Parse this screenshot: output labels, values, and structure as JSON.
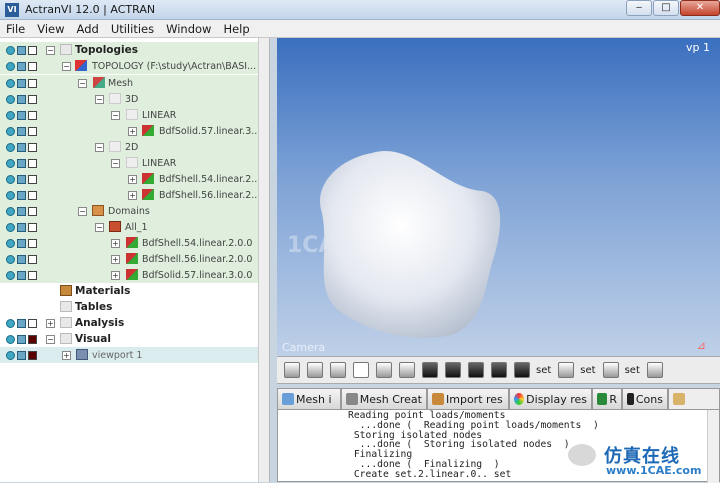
{
  "window": {
    "title": "ActranVI 12.0 | ACTRAN",
    "app_icon": "VI",
    "minimize": "‒",
    "maximize": "□",
    "close": "✕"
  },
  "menu": [
    "File",
    "View",
    "Add",
    "Utilities",
    "Window",
    "Help"
  ],
  "tree": {
    "topologies": "Topologies",
    "topology": "TOPOLOGY (F:\\study\\Actran\\BASI...",
    "mesh": "Mesh",
    "d3": "3D",
    "linear3": "LINEAR",
    "bdfsolid": "BdfSolid.57.linear.3....",
    "d2": "2D",
    "linear2": "LINEAR",
    "bdfshell54": "BdfShell.54.linear.2....",
    "bdfshell56": "BdfShell.56.linear.2....",
    "domains": "Domains",
    "all1": "All_1",
    "dom_shell54": "BdfShell.54.linear.2.0.0",
    "dom_shell56": "BdfShell.56.linear.2.0.0",
    "dom_solid57": "BdfSolid.57.linear.3.0.0",
    "materials": "Materials",
    "tables": "Tables",
    "analysis": "Analysis",
    "visual": "Visual",
    "viewport": "viewport 1"
  },
  "viewport": {
    "label": "vp 1",
    "camera": "Camera",
    "watermark": "1CAE.COM"
  },
  "toolbar": {
    "set1": "set",
    "set2": "set",
    "set3": "set"
  },
  "tabs": [
    "Mesh i",
    "Mesh Creat",
    "Import res",
    "Display res",
    "R",
    "Cons"
  ],
  "console": {
    "lines": [
      "Reading point loads/moments",
      "  ...done (  Reading point loads/moments  )",
      " Storing isolated nodes",
      "  ...done (  Storing isolated nodes  )",
      " Finalizing",
      "  ...done (  Finalizing  )",
      " Create set.2.linear.0.. set"
    ]
  },
  "watermark_bottom": {
    "cn": "仿真在线",
    "site": "www.1CAE.com"
  }
}
